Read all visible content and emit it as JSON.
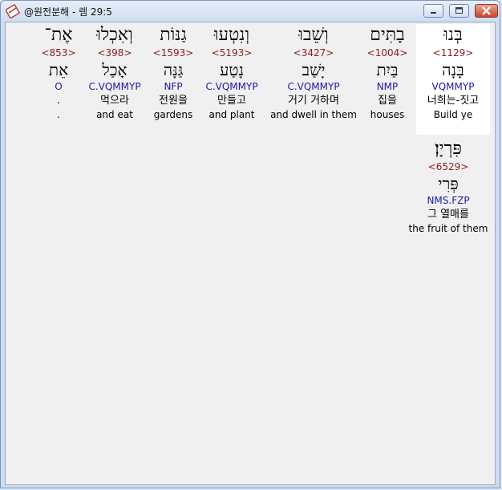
{
  "window": {
    "title": "@원전분해 - 렘 29:5",
    "buttons": [
      "minimize",
      "maximize",
      "close"
    ]
  },
  "words": [
    {
      "hebrew": "בְּנוּ",
      "strong": "<1129>",
      "lemma": "בָּנָה",
      "parse": "VQMMYP",
      "korean": "너희는-짓고",
      "english": "Build ye"
    },
    {
      "hebrew": "בָתִּים",
      "strong": "<1004>",
      "lemma": "בַּיִת",
      "parse": "NMP",
      "korean": "집을",
      "english": "houses"
    },
    {
      "hebrew": "וְשֵׁבוּ",
      "strong": "<3427>",
      "lemma": "יָשַׁב",
      "parse": "C.VQMMYP",
      "korean": "거기 거하며",
      "english": "and  dwell in them"
    },
    {
      "hebrew": "וְנִטְעוּ",
      "strong": "<5193>",
      "lemma": "נָטַע",
      "parse": "C.VQMMYP",
      "korean": "만들고",
      "english": "and plant"
    },
    {
      "hebrew": "גַנּוֹת",
      "strong": "<1593>",
      "lemma": "גַּנָּה",
      "parse": "NFP",
      "korean": "전원을",
      "english": "gardens"
    },
    {
      "hebrew": "וְאִכְלוּ",
      "strong": "<398>",
      "lemma": "אָכַל",
      "parse": "C.VQMMYP",
      "korean": "먹으라",
      "english": "and eat"
    },
    {
      "hebrew": "אֶת־",
      "strong": "<853>",
      "lemma": "אֵת",
      "parse": "O",
      "korean": ".",
      "english": "."
    },
    {
      "hebrew": "פִּרְיָן׃",
      "strong": "<6529>",
      "lemma": "פְּרִי",
      "parse": "NMS.FZP",
      "korean": "그 열매를",
      "english": "the fruit of them"
    }
  ]
}
